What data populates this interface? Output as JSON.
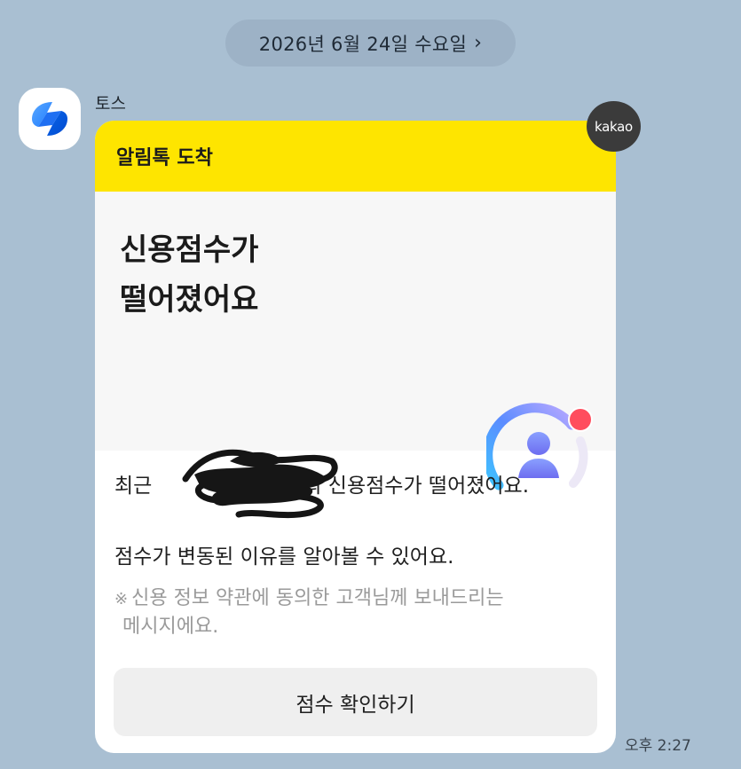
{
  "date_separator": {
    "label": "2026년 6월 24일 수요일",
    "chevron_icon": "chevron-right-icon"
  },
  "sender": {
    "name": "토스",
    "avatar_icon": "toss-logo-icon",
    "brand_color": "#1f7cff"
  },
  "message": {
    "header": "알림톡 도착",
    "header_color": "#fee500",
    "title_line1": "신용점수가",
    "title_line2": "떨어졌어요",
    "body_prefix": "최근",
    "body_suffix": "의 신용점수가 떨어졌어요.",
    "body_line2": "점수가 변동된 이유를 알아볼 수 있어요.",
    "notice_mark": "※",
    "notice_line1": "신용 정보 약관에 동의한 고객님께 보내드리는",
    "notice_line2": "메시지에요.",
    "cta_label": "점수 확인하기",
    "badge_label": "kakao",
    "time": "오후 2:27"
  }
}
